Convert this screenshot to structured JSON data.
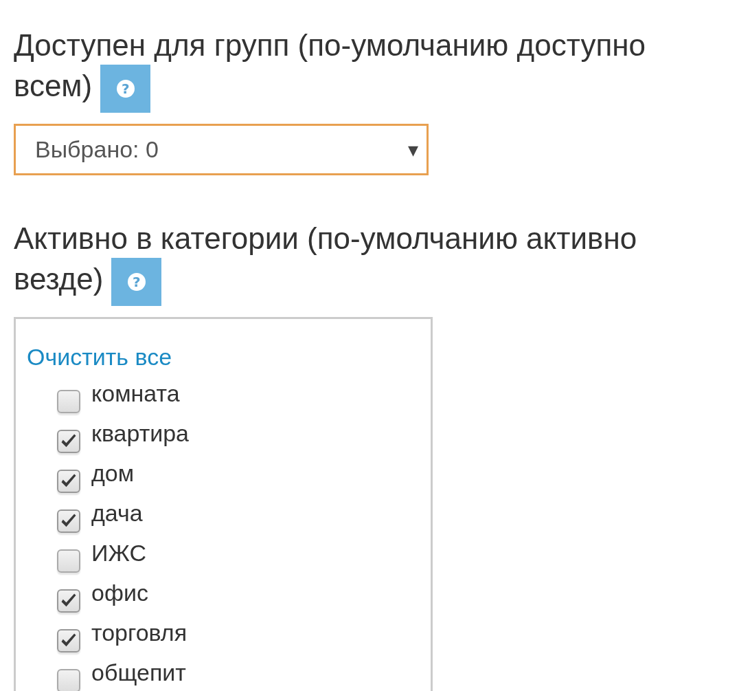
{
  "sections": [
    {
      "kind": "select",
      "title": "Доступен для групп (по-умолчанию доступно всем)",
      "help": "?",
      "select": {
        "value": "Выбрано: 0",
        "arrow": "▾"
      }
    },
    {
      "kind": "checklist",
      "title": "Активно в категории (по-умолчанию активно везде)",
      "help": "?",
      "clear_link": "Очистить все",
      "items": [
        {
          "label": "комната",
          "checked": false
        },
        {
          "label": "квартира",
          "checked": true
        },
        {
          "label": "дом",
          "checked": true
        },
        {
          "label": "дача",
          "checked": true
        },
        {
          "label": "ИЖС",
          "checked": false
        },
        {
          "label": "офис",
          "checked": true
        },
        {
          "label": "торговля",
          "checked": true
        },
        {
          "label": "общепит",
          "checked": false
        }
      ]
    }
  ]
}
